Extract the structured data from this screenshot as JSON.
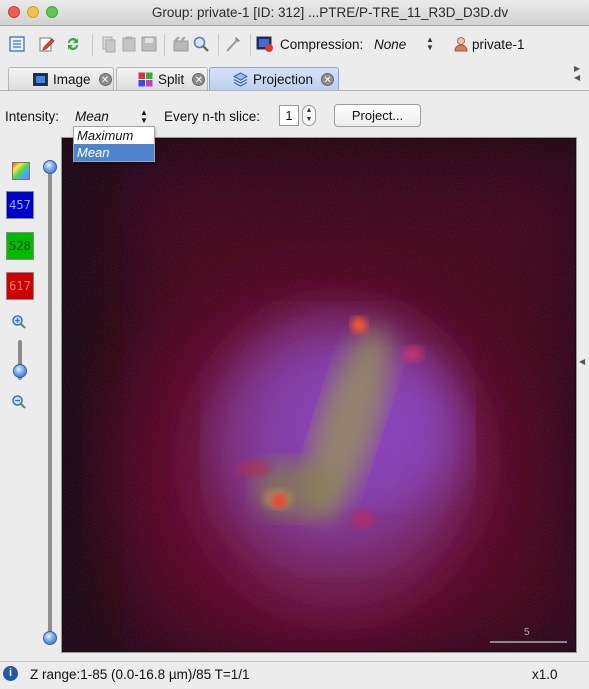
{
  "window": {
    "title": "Group: private-1 [ID: 312] ...PTRE/P-TRE_11_R3D_D3D.dv"
  },
  "toolbar": {
    "icons": [
      "metadata-icon",
      "edit-icon",
      "refresh-icon",
      "copy-icon",
      "paste-icon",
      "save-icon",
      "film-icon",
      "zoom-icon",
      "measure-icon",
      "image-compression-icon"
    ],
    "compression_label": "Compression:",
    "compression_value": "None",
    "owner_name": "private-1"
  },
  "tabs": [
    {
      "label": "Image",
      "icon": "image-icon",
      "active": false
    },
    {
      "label": "Split",
      "icon": "split-grid-icon",
      "active": false
    },
    {
      "label": "Projection",
      "icon": "layers-icon",
      "active": true
    }
  ],
  "projection": {
    "intensity_label": "Intensity:",
    "intensity_value": "Mean",
    "intensity_options": [
      "Maximum",
      "Mean"
    ],
    "slice_label": "Every n-th slice:",
    "slice_value": "1",
    "project_button": "Project..."
  },
  "channels": [
    {
      "label": "457",
      "color": "#0000cc",
      "text_color": "#8fb0ff"
    },
    {
      "label": "528",
      "color": "#00bb00",
      "text_color": "#0c4f0c"
    },
    {
      "label": "617",
      "color": "#cc0000",
      "text_color": "#ff7a7a"
    }
  ],
  "viewer": {
    "scale_bar_label": "5"
  },
  "status": {
    "text": "Z range:1-85 (0.0-16.8 µm)/85 T=1/1",
    "zoom": "x1.0"
  }
}
